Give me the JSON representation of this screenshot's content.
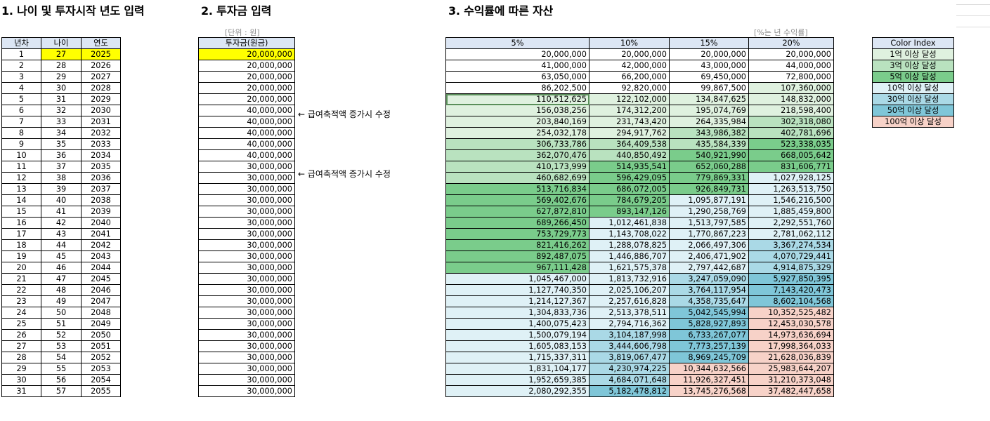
{
  "titles": {
    "s1": "1. 나이 및 투자시작 년도 입력",
    "s2": "2. 투자금 입력",
    "s3": "3. 수익률에 따른 자산"
  },
  "units": {
    "won": "[단위 : 원]",
    "rate": "[%는 년 수익률]"
  },
  "notes": {
    "n1": "← 급여축적액 증가시 수정",
    "n2": "← 급여축적액 증가시 수정"
  },
  "colors": {
    "header": "#dce6f4",
    "input_yellow": "#ffff00",
    "over_100m": "#dff1df",
    "over_300m": "#b9e2bf",
    "over_500m": "#7acc8b",
    "over_1b": "#dff1f6",
    "over_3b": "#aad9e6",
    "over_5b": "#7fc6d8",
    "over_10b": "#f7d2c8"
  },
  "table1": {
    "headers": [
      "년차",
      "나이",
      "연도"
    ],
    "rows": [
      [
        "1",
        "27",
        "2025"
      ],
      [
        "2",
        "28",
        "2026"
      ],
      [
        "3",
        "29",
        "2027"
      ],
      [
        "4",
        "30",
        "2028"
      ],
      [
        "5",
        "31",
        "2029"
      ],
      [
        "6",
        "32",
        "2030"
      ],
      [
        "7",
        "33",
        "2031"
      ],
      [
        "8",
        "34",
        "2032"
      ],
      [
        "9",
        "35",
        "2033"
      ],
      [
        "10",
        "36",
        "2034"
      ],
      [
        "11",
        "37",
        "2035"
      ],
      [
        "12",
        "38",
        "2036"
      ],
      [
        "13",
        "39",
        "2037"
      ],
      [
        "14",
        "40",
        "2038"
      ],
      [
        "15",
        "41",
        "2039"
      ],
      [
        "16",
        "42",
        "2040"
      ],
      [
        "17",
        "43",
        "2041"
      ],
      [
        "18",
        "44",
        "2042"
      ],
      [
        "19",
        "45",
        "2043"
      ],
      [
        "20",
        "46",
        "2044"
      ],
      [
        "21",
        "47",
        "2045"
      ],
      [
        "22",
        "48",
        "2046"
      ],
      [
        "23",
        "49",
        "2047"
      ],
      [
        "24",
        "50",
        "2048"
      ],
      [
        "25",
        "51",
        "2049"
      ],
      [
        "26",
        "52",
        "2050"
      ],
      [
        "27",
        "53",
        "2051"
      ],
      [
        "28",
        "54",
        "2052"
      ],
      [
        "29",
        "55",
        "2053"
      ],
      [
        "30",
        "56",
        "2054"
      ],
      [
        "31",
        "57",
        "2055"
      ]
    ]
  },
  "table2": {
    "header": "투자금(원금)",
    "rows": [
      "20,000,000",
      "20,000,000",
      "20,000,000",
      "20,000,000",
      "20,000,000",
      "40,000,000",
      "40,000,000",
      "40,000,000",
      "40,000,000",
      "40,000,000",
      "30,000,000",
      "30,000,000",
      "30,000,000",
      "30,000,000",
      "30,000,000",
      "30,000,000",
      "30,000,000",
      "30,000,000",
      "30,000,000",
      "30,000,000",
      "30,000,000",
      "30,000,000",
      "30,000,000",
      "30,000,000",
      "30,000,000",
      "30,000,000",
      "30,000,000",
      "30,000,000",
      "30,000,000",
      "30,000,000",
      "30,000,000"
    ]
  },
  "table3": {
    "headers": [
      "5%",
      "10%",
      "15%",
      "20%"
    ],
    "rows": [
      [
        "20,000,000",
        "20,000,000",
        "20,000,000",
        "20,000,000"
      ],
      [
        "41,000,000",
        "42,000,000",
        "43,000,000",
        "44,000,000"
      ],
      [
        "63,050,000",
        "66,200,000",
        "69,450,000",
        "72,800,000"
      ],
      [
        "86,202,500",
        "92,820,000",
        "99,867,500",
        "107,360,000"
      ],
      [
        "110,512,625",
        "122,102,000",
        "134,847,625",
        "148,832,000"
      ],
      [
        "156,038,256",
        "174,312,200",
        "195,074,769",
        "218,598,400"
      ],
      [
        "203,840,169",
        "231,743,420",
        "264,335,984",
        "302,318,080"
      ],
      [
        "254,032,178",
        "294,917,762",
        "343,986,382",
        "402,781,696"
      ],
      [
        "306,733,786",
        "364,409,538",
        "435,584,339",
        "523,338,035"
      ],
      [
        "362,070,476",
        "440,850,492",
        "540,921,990",
        "668,005,642"
      ],
      [
        "410,173,999",
        "514,935,541",
        "652,060,288",
        "831,606,771"
      ],
      [
        "460,682,699",
        "596,429,095",
        "779,869,331",
        "1,027,928,125"
      ],
      [
        "513,716,834",
        "686,072,005",
        "926,849,731",
        "1,263,513,750"
      ],
      [
        "569,402,676",
        "784,679,205",
        "1,095,877,191",
        "1,546,216,500"
      ],
      [
        "627,872,810",
        "893,147,126",
        "1,290,258,769",
        "1,885,459,800"
      ],
      [
        "689,266,450",
        "1,012,461,838",
        "1,513,797,585",
        "2,292,551,760"
      ],
      [
        "753,729,773",
        "1,143,708,022",
        "1,770,867,223",
        "2,781,062,112"
      ],
      [
        "821,416,262",
        "1,288,078,825",
        "2,066,497,306",
        "3,367,274,534"
      ],
      [
        "892,487,075",
        "1,446,886,707",
        "2,406,471,902",
        "4,070,729,441"
      ],
      [
        "967,111,428",
        "1,621,575,378",
        "2,797,442,687",
        "4,914,875,329"
      ],
      [
        "1,045,467,000",
        "1,813,732,916",
        "3,247,059,090",
        "5,927,850,395"
      ],
      [
        "1,127,740,350",
        "2,025,106,207",
        "3,764,117,954",
        "7,143,420,473"
      ],
      [
        "1,214,127,367",
        "2,257,616,828",
        "4,358,735,647",
        "8,602,104,568"
      ],
      [
        "1,304,833,736",
        "2,513,378,511",
        "5,042,545,994",
        "10,352,525,482"
      ],
      [
        "1,400,075,423",
        "2,794,716,362",
        "5,828,927,893",
        "12,453,030,578"
      ],
      [
        "1,500,079,194",
        "3,104,187,998",
        "6,733,267,077",
        "14,973,636,694"
      ],
      [
        "1,605,083,153",
        "3,444,606,798",
        "7,773,257,139",
        "17,998,364,033"
      ],
      [
        "1,715,337,311",
        "3,819,067,477",
        "8,969,245,709",
        "21,628,036,839"
      ],
      [
        "1,831,104,177",
        "4,230,974,225",
        "10,344,632,566",
        "25,983,644,207"
      ],
      [
        "1,952,659,385",
        "4,684,071,648",
        "11,926,327,451",
        "31,210,373,048"
      ],
      [
        "2,080,292,355",
        "5,182,478,812",
        "13,745,276,568",
        "37,482,447,658"
      ]
    ]
  },
  "legend": {
    "header": "Color Index",
    "items": [
      {
        "label": "1억 이상 달성",
        "color": "#dff1df"
      },
      {
        "label": "3억 이상 달성",
        "color": "#b9e2bf"
      },
      {
        "label": "5억 이상 달성",
        "color": "#7acc8b"
      },
      {
        "label": "10억 이상 달성",
        "color": "#dff1f6"
      },
      {
        "label": "30억 이상 달성",
        "color": "#aad9e6"
      },
      {
        "label": "50억 이상 달성",
        "color": "#7fc6d8"
      },
      {
        "label": "100억 이상 달성",
        "color": "#f7d2c8"
      }
    ]
  }
}
